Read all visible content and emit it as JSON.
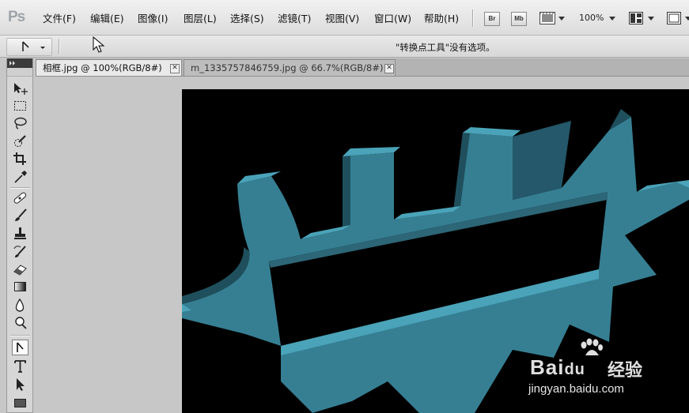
{
  "app": {
    "logo": "Ps"
  },
  "menu": {
    "items": [
      "文件(F)",
      "编辑(E)",
      "图像(I)",
      "图层(L)",
      "选择(S)",
      "滤镜(T)",
      "视图(V)",
      "窗口(W)",
      "帮助(H)"
    ]
  },
  "app_bar": {
    "bridge_label": "Br",
    "minibridge_label": "Mb",
    "zoom": "100%"
  },
  "options_bar": {
    "message": "\"转换点工具\"没有选项。"
  },
  "tabs": [
    {
      "label": "相框.jpg @ 100%(RGB/8#)",
      "close": "✕",
      "active": true
    },
    {
      "label": "m_1335757846759.jpg @ 66.7%(RGB/8#)",
      "close": "✕",
      "active": false
    }
  ],
  "tools": [
    {
      "name": "move-tool-icon"
    },
    {
      "name": "rectangular-marquee-tool-icon"
    },
    {
      "name": "lasso-tool-icon"
    },
    {
      "name": "quick-selection-tool-icon"
    },
    {
      "name": "crop-tool-icon"
    },
    {
      "name": "eyedropper-tool-icon"
    },
    {
      "name": "spot-healing-brush-tool-icon"
    },
    {
      "name": "brush-tool-icon"
    },
    {
      "name": "clone-stamp-tool-icon"
    },
    {
      "name": "history-brush-tool-icon"
    },
    {
      "name": "eraser-tool-icon"
    },
    {
      "name": "gradient-tool-icon"
    },
    {
      "name": "blur-tool-icon"
    },
    {
      "name": "dodge-tool-icon"
    },
    {
      "name": "convert-point-tool-icon"
    },
    {
      "name": "type-tool-icon",
      "glyph": "T"
    },
    {
      "name": "path-selection-tool-icon"
    },
    {
      "name": "rectangle-tool-icon"
    }
  ],
  "watermark": {
    "brand": "Bai",
    "brand_suffix": "du",
    "product": "经验",
    "url": "jingyan.baidu.com"
  },
  "colors": {
    "frame_top": "#4aa3b8",
    "frame_face": "#367f93",
    "frame_shadow": "#1f4f5c",
    "canvas_bg": "#000000",
    "workspace_bg": "#c7c7c7"
  }
}
